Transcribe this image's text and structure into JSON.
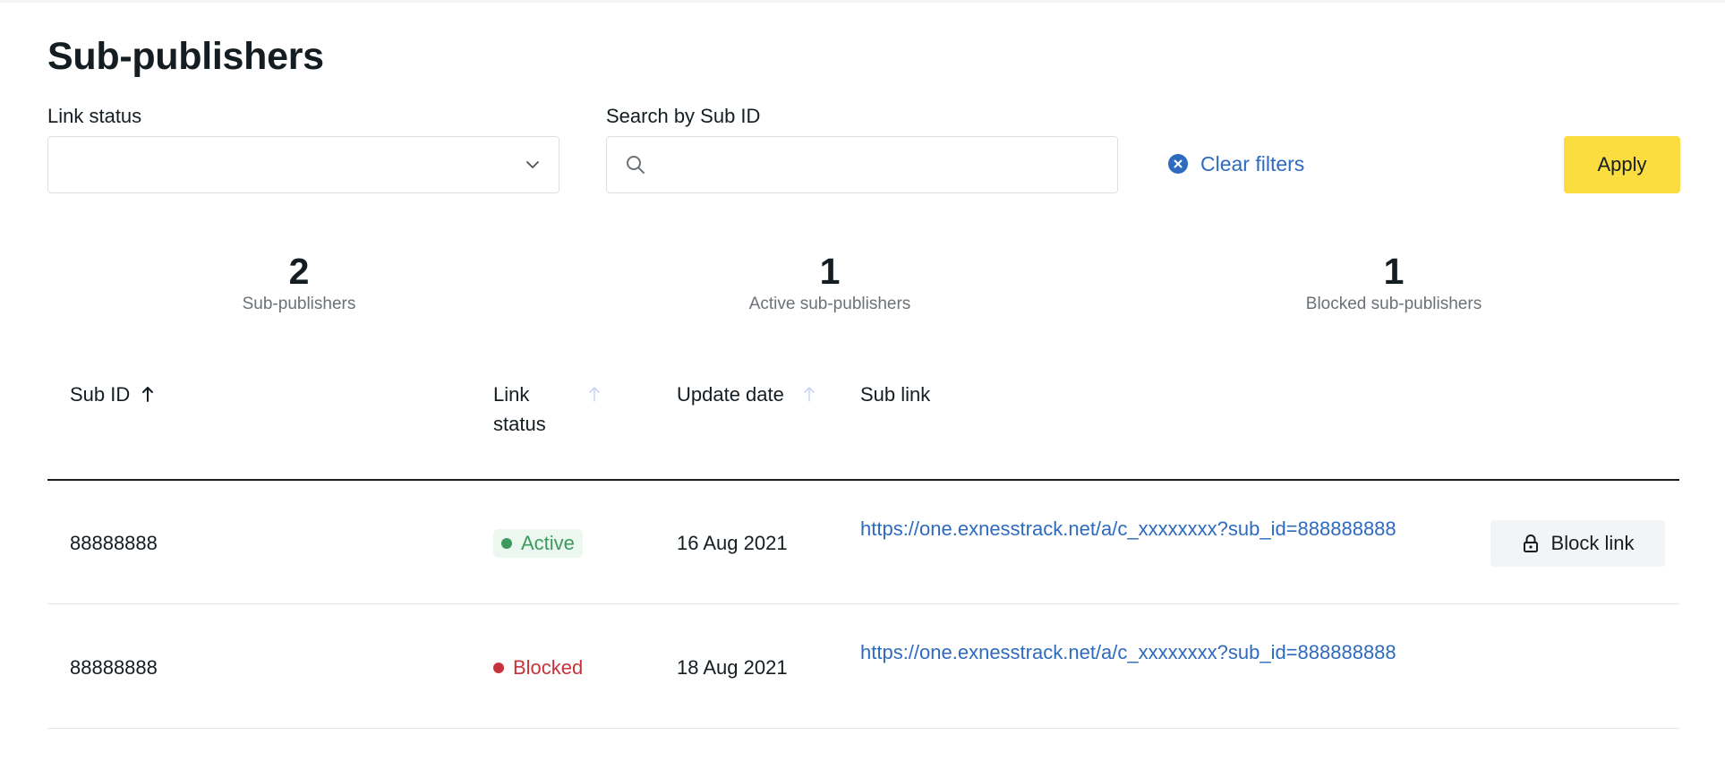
{
  "page": {
    "title": "Sub-publishers"
  },
  "filters": {
    "link_status_label": "Link status",
    "link_status_value": "",
    "search_label": "Search by Sub ID",
    "search_value": "",
    "search_placeholder": "",
    "clear_filters_label": "Clear filters",
    "apply_label": "Apply"
  },
  "stats": [
    {
      "value": "2",
      "caption": "Sub-publishers"
    },
    {
      "value": "1",
      "caption": "Active sub-publishers"
    },
    {
      "value": "1",
      "caption": "Blocked sub-publishers"
    }
  ],
  "table": {
    "headers": {
      "sub_id": "Sub ID",
      "link_status_line1": "Link",
      "link_status_line2": "status",
      "update_date": "Update date",
      "sub_link": "Sub link"
    },
    "sort": {
      "active_column": "Sub ID",
      "direction": "ascending"
    },
    "rows": [
      {
        "sub_id": "88888888",
        "status": "Active",
        "update_date": "16 Aug 2021",
        "sub_link": "https://one.exnesstrack.net/a/c_xxxxxxxx?sub_id=888888888",
        "action_label": "Block link"
      },
      {
        "sub_id": "88888888",
        "status": "Blocked",
        "update_date": "18 Aug 2021",
        "sub_link": "https://one.exnesstrack.net/a/c_xxxxxxxx?sub_id=888888888",
        "action_label": ""
      }
    ]
  },
  "icons": {
    "chevron": "chevron-down-icon",
    "search": "search-icon",
    "clear": "close-circle-icon",
    "sort": "arrow-up-icon",
    "lock": "lock-icon"
  },
  "colors": {
    "accent_yellow": "#fbdd3f",
    "link_blue": "#2e6bbf",
    "active_green": "#3d9a5e",
    "active_bg": "#ecf7ef",
    "blocked_red": "#c8323a",
    "sort_inactive": "#c9d6f3"
  }
}
